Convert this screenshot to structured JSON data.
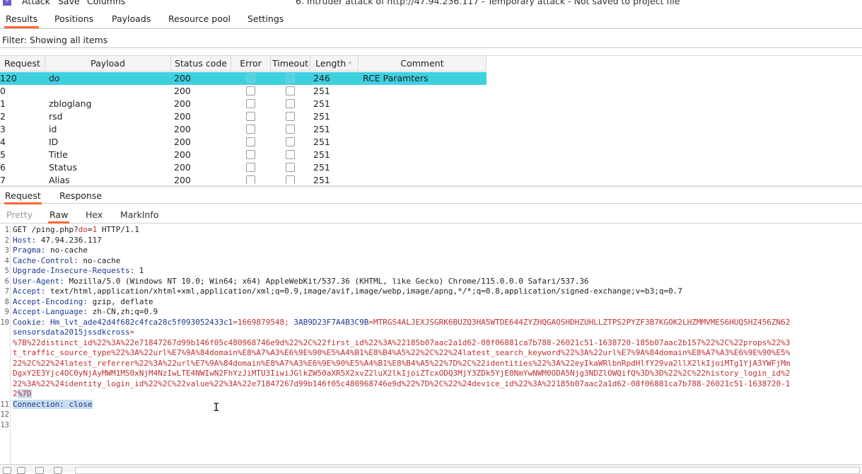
{
  "titlebar": {
    "menu": [
      "Attack",
      "Save",
      "Columns"
    ],
    "title": "6. Intruder attack of http://47.94.236.117 - Temporary attack - Not saved to project file"
  },
  "main_tabs": [
    "Results",
    "Positions",
    "Payloads",
    "Resource pool",
    "Settings"
  ],
  "filter": "Filter: Showing all items",
  "table": {
    "headers": [
      "Request",
      "Payload",
      "Status code",
      "Error",
      "Timeout",
      "Length",
      "Comment"
    ],
    "rows": [
      {
        "request": "120",
        "payload": "do",
        "status": "200",
        "length": "246",
        "comment": "RCE Paramters"
      },
      {
        "request": "0",
        "payload": "",
        "status": "200",
        "length": "251",
        "comment": ""
      },
      {
        "request": "1",
        "payload": "zbloglang",
        "status": "200",
        "length": "251",
        "comment": ""
      },
      {
        "request": "2",
        "payload": "rsd",
        "status": "200",
        "length": "251",
        "comment": ""
      },
      {
        "request": "3",
        "payload": "id",
        "status": "200",
        "length": "251",
        "comment": ""
      },
      {
        "request": "4",
        "payload": "ID",
        "status": "200",
        "length": "251",
        "comment": ""
      },
      {
        "request": "5",
        "payload": "Title",
        "status": "200",
        "length": "251",
        "comment": ""
      },
      {
        "request": "6",
        "payload": "Status",
        "status": "200",
        "length": "251",
        "comment": ""
      },
      {
        "request": "7",
        "payload": "Alias",
        "status": "200",
        "length": "251",
        "comment": ""
      }
    ]
  },
  "rr_tabs": [
    "Request",
    "Response"
  ],
  "view_tabs": [
    "Pretty",
    "Raw",
    "Hex",
    "MarkInfo"
  ],
  "editor": {
    "line_numbers": [
      "1",
      "2",
      "3",
      "4",
      "5",
      "6",
      "7",
      "8",
      "9",
      "10",
      "",
      "",
      "",
      "",
      "",
      "",
      "",
      "11",
      "12",
      "13"
    ],
    "l1_method": "GET /ping.php?",
    "l1_param": "do",
    "l1_eq": "=",
    "l1_val": "1",
    "l1_proto": " HTTP/1.1",
    "host_k": "Host:",
    "host_v": " 47.94.236.117",
    "pragma_k": "Pragma:",
    "pragma_v": " no-cache",
    "cc_k": "Cache-Control:",
    "cc_v": " no-cache",
    "uir_k": "Upgrade-Insecure-Requests:",
    "uir_v": " 1",
    "ua_k": "User-Agent:",
    "ua_v": " Mozilla/5.0 (Windows NT 10.0; Win64; x64) AppleWebKit/537.36 (KHTML, like Gecko) Chrome/115.0.0.0 Safari/537.36",
    "acc_k": "Accept:",
    "acc_v": " text/html,application/xhtml+xml,application/xml;q=0.9,image/avif,image/webp,image/apng,*/*;q=0.8,application/signed-exchange;v=b3;q=0.7",
    "ae_k": "Accept-Encoding:",
    "ae_v": " gzip, deflate",
    "al_k": "Accept-Language:",
    "al_v": " zh-CN,zh;q=0.9",
    "ck_k": "Cookie:",
    "ck_n1": " Hm_lvt_ade42d4f682c4fca28c5f093052433c1",
    "ck_v1": "=1669879548; ",
    "ck_n2": "3AB9D23F7A4B3C9B",
    "ck_v2": "=MTRGS4ALJEXJSGRK6BUZQ3HA5WTDE644ZYZHQGAOSHDHZUHLLZTPS2PYZF3B7KGOK2LHZMMVMES6HUQSHZ456ZN62",
    "ck_n3": "sensorsdata2015jssdkcross",
    "ck_eq3": "=",
    "w1": "%7B%22distinct_id%22%3A%22e71847267d99b146f05c480968746e9d%22%2C%22first_id%22%3A%22185b07aac2a1d62-08f06881ca7b788-26021c51-1638720-185b07aac2b157%22%2C%22props%22%3",
    "w2": "t_traffic_source_type%22%3A%22url%E7%9A%84domain%E8%A7%A3%E6%9E%90%E5%A4%B1%E8%B4%A5%22%2C%22%24latest_search_keyword%22%3A%22url%E7%9A%84domain%E8%A7%A3%E6%9E%90%E5%",
    "w3": "22%2C%22%24latest_referrer%22%3A%22url%E7%9A%84domain%E8%A7%A3%E6%9E%90%E5%A4%B1%E8%B4%A5%22%7D%2C%22identities%22%3A%22eyIkaWRlbnRpdHlfY29va2llX2lkIjoiMTg1YjA3YWFjMm",
    "w4": "DgxY2E3Yjc4OC0yNjAyMWM1MS0xNjM4NzIwLTE4NWIwN2FhYzJiMTU3IiwiJGlkZW50aXR5X2xvZ2luX2lkIjoiZTcxODQ3MjY3ZDk5YjE0NmYwNWM0ODA5Njg3NDZlOWQifQ%3D%3D%22%2C%22history_login_id%2",
    "w5": "22%3A%22%24identity_login_id%22%2C%22value%22%3A%22e71847267d99b146f05c480968746e9d%22%7D%2C%22%24device_id%22%3A%22185b07aac2a1d62-08f06881ca7b788-26021c51-1638720-1",
    "w6a": "2",
    "w6b": "%7D",
    "conn": "Connection: close"
  }
}
